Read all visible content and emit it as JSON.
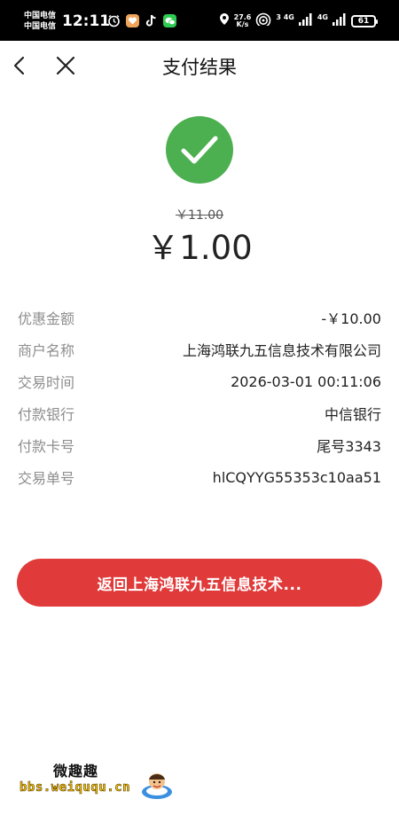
{
  "status_bar": {
    "carrier_line1": "中国电信",
    "carrier_line2": "中国电信",
    "time": "12:11",
    "net_speed_value": "27.6",
    "net_speed_unit": "K/s",
    "signal1_label": "3 4G",
    "signal2_label": "4G",
    "battery": "61",
    "icons": [
      "alarm-icon",
      "app-icon",
      "tiktok-icon",
      "wechat-icon",
      "location-icon",
      "wifi-icon"
    ]
  },
  "nav": {
    "title": "支付结果",
    "back_icon": "chevron-left-icon",
    "close_icon": "close-icon"
  },
  "result": {
    "status_icon": "check-icon",
    "status_color": "#4caf50",
    "original_price": "￥11.00",
    "paid_amount": "￥1.00"
  },
  "details": [
    {
      "label": "优惠金额",
      "value": "-￥10.00"
    },
    {
      "label": "商户名称",
      "value": "上海鸿联九五信息技术有限公司"
    },
    {
      "label": "交易时间",
      "value": "2026-03-01 00:11:06"
    },
    {
      "label": "付款银行",
      "value": "中信银行"
    },
    {
      "label": "付款卡号",
      "value": "尾号3343"
    },
    {
      "label": "交易单号",
      "value": "hlCQYYG55353c10aa51"
    }
  ],
  "return_button": {
    "label": "返回上海鸿联九五信息技术...",
    "color": "#e03a3a"
  },
  "watermark": {
    "title": "微趣趣",
    "url": "bbs.weiququ.cn"
  }
}
